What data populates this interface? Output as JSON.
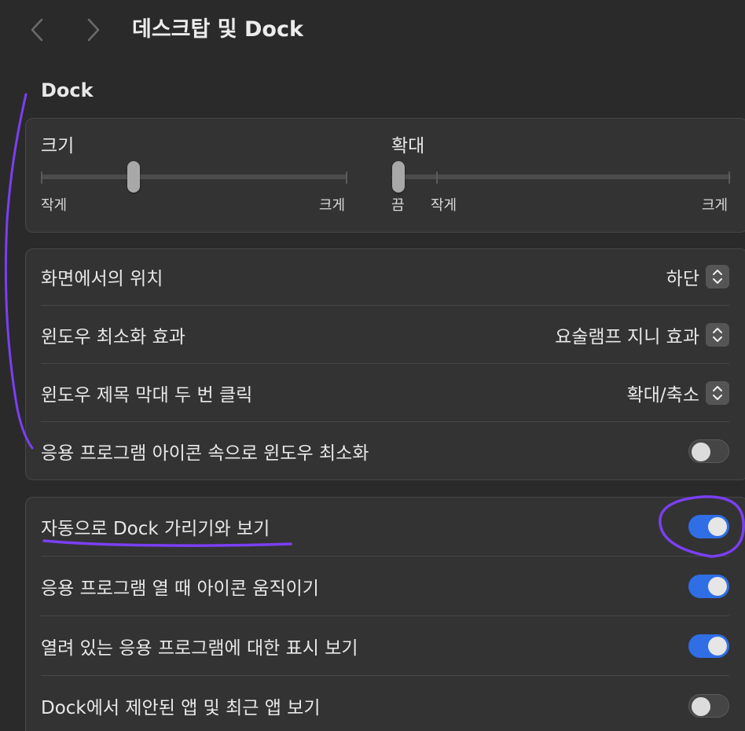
{
  "toolbar": {
    "back_icon": "chevron-left-icon",
    "forward_icon": "chevron-right-icon",
    "title": "데스크탑 및 Dock"
  },
  "section": {
    "title": "Dock"
  },
  "sliders": {
    "size": {
      "label": "크기",
      "min_label": "작게",
      "max_label": "크게",
      "value_fraction": 0.3
    },
    "magnification": {
      "label": "확대",
      "off_label": "끔",
      "min_label": "작게",
      "max_label": "크게",
      "value": "끔"
    }
  },
  "settings_group1": [
    {
      "label": "화면에서의 위치",
      "control": "popup",
      "value": "하단"
    },
    {
      "label": "윈도우 최소화 효과",
      "control": "popup",
      "value": "요술램프 지니 효과"
    },
    {
      "label": "윈도우 제목 막대 두 번 클릭",
      "control": "popup",
      "value": "확대/축소"
    },
    {
      "label": "응용 프로그램 아이콘 속으로 윈도우 최소화",
      "control": "toggle",
      "on": false
    }
  ],
  "settings_group2": [
    {
      "label": "자동으로 Dock 가리기와 보기",
      "control": "toggle",
      "on": true
    },
    {
      "label": "응용 프로그램 열 때 아이콘 움직이기",
      "control": "toggle",
      "on": true
    },
    {
      "label": "열려 있는 응용 프로그램에 대한 표시 보기",
      "control": "toggle",
      "on": true
    },
    {
      "label": "Dock에서 제안된 앱 및 최근 앱 보기",
      "control": "toggle",
      "on": false
    }
  ],
  "colors": {
    "background": "#2a2a2a",
    "card": "#333333",
    "toggle_on": "#2f6ee5",
    "annotation": "#7b3ff2"
  }
}
